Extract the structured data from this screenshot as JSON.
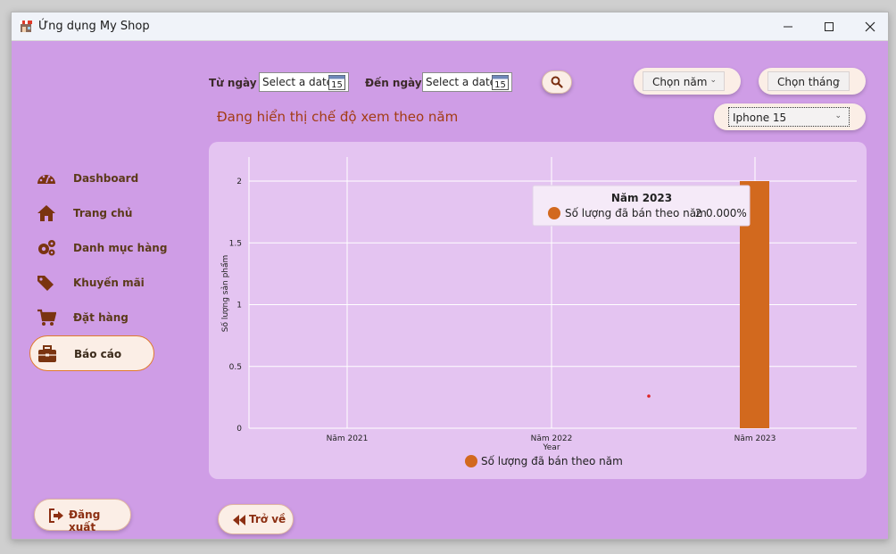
{
  "window": {
    "title": "Ứng dụng My Shop"
  },
  "filters": {
    "from_label": "Từ ngày",
    "from_placeholder": "Select a date",
    "to_label": "Đến ngày",
    "to_placeholder": "Select a date",
    "calendar_day": "15",
    "year_select": "Chọn năm",
    "month_select": "Chọn tháng",
    "product_select": "Iphone 15"
  },
  "mode_text": "Đang hiển thị chế độ xem theo năm",
  "sidebar": {
    "items": [
      {
        "label": "Dashboard",
        "icon": "dashboard-icon"
      },
      {
        "label": "Trang chủ",
        "icon": "home-icon"
      },
      {
        "label": "Danh mục hàng",
        "icon": "gears-icon"
      },
      {
        "label": "Khuyến mãi",
        "icon": "tags-icon"
      },
      {
        "label": "Đặt hàng",
        "icon": "cart-icon"
      },
      {
        "label": "Báo cáo",
        "icon": "briefcase-icon",
        "active": true
      }
    ]
  },
  "buttons": {
    "logout": "Đăng xuất",
    "back": "Trở về"
  },
  "colors": {
    "accent": "#d2691e",
    "background": "#cf9de6",
    "card": "#e4c4f1",
    "text_dark": "#5b3a1a"
  },
  "chart_data": {
    "type": "bar",
    "categories": [
      "Năm 2021",
      "Năm 2022",
      "Năm 2023"
    ],
    "series": [
      {
        "name": "Số lượng đã bán theo năm",
        "values": [
          0,
          0,
          2
        ]
      }
    ],
    "xlabel": "Year",
    "ylabel": "Số lượng sản phẩm",
    "ylim": [
      0,
      2
    ],
    "yticks": [
      "0",
      "0.5",
      "1",
      "1.5",
      "2"
    ],
    "grid": true,
    "legend": "bottom",
    "tooltip": {
      "title": "Năm 2023",
      "series": "Số lượng đã bán theo năm",
      "value": "2",
      "percent": "0.000%"
    }
  }
}
